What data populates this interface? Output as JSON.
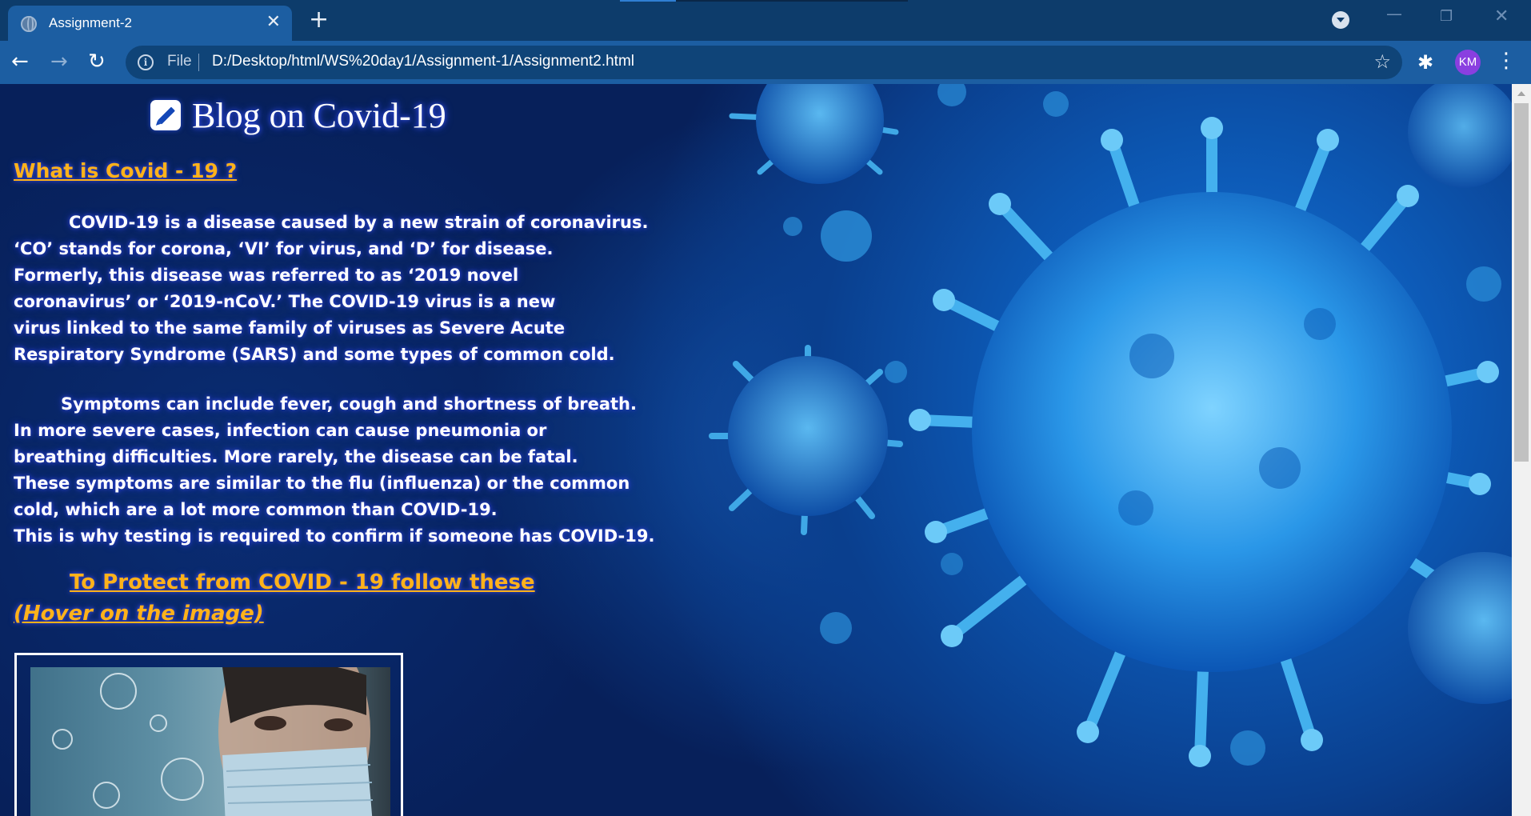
{
  "browser": {
    "tab_title": "Assignment-2",
    "tab_close": "✕",
    "new_tab": "+",
    "url_scheme": "File",
    "url": "D:/Desktop/html/WS%20day1/Assignment-1/Assignment2.html",
    "profile_initials": "KM",
    "icons": {
      "back": "←",
      "forward": "→",
      "reload": "↻",
      "info": "i",
      "bookmark": "☆",
      "extensions": "✱",
      "menu": "⋮",
      "minimize": "—",
      "maximize": "❐",
      "close": "✕"
    },
    "colors": {
      "tab_bar": "#0d3c6b",
      "toolbar": "#1c5ea2",
      "avatar": "#8a3fe0"
    }
  },
  "page": {
    "title": "Blog on Covid-19",
    "heading_what": "What is Covid - 19 ?",
    "para1": [
      "COVID-19 is a disease caused by a new strain of coronavirus.",
      "‘CO’ stands for corona, ‘VI’ for virus, and ‘D’ for disease.",
      "Formerly, this disease was referred to as ‘2019 novel",
      "coronavirus’ or ‘2019-nCoV.’ The COVID-19 virus is a new",
      "virus linked to the same family of viruses as Severe Acute",
      "Respiratory Syndrome (SARS) and some types of common cold."
    ],
    "para2": [
      "Symptoms can include fever, cough and shortness of breath.",
      "In more severe cases, infection can cause pneumonia or",
      "breathing difficulties. More rarely, the disease can be fatal.",
      "These symptoms are similar to the flu (influenza) or the common",
      "cold, which are a lot more common than COVID-19.",
      "This is why testing is required to confirm if someone has COVID-19."
    ],
    "heading_protect": "To Protect from COVID - 19 follow these",
    "heading_hover": "(Hover on the image)",
    "colors": {
      "heading": "#ffb21a",
      "text": "#ffffff",
      "text_glow": "#2a3fcc"
    }
  }
}
